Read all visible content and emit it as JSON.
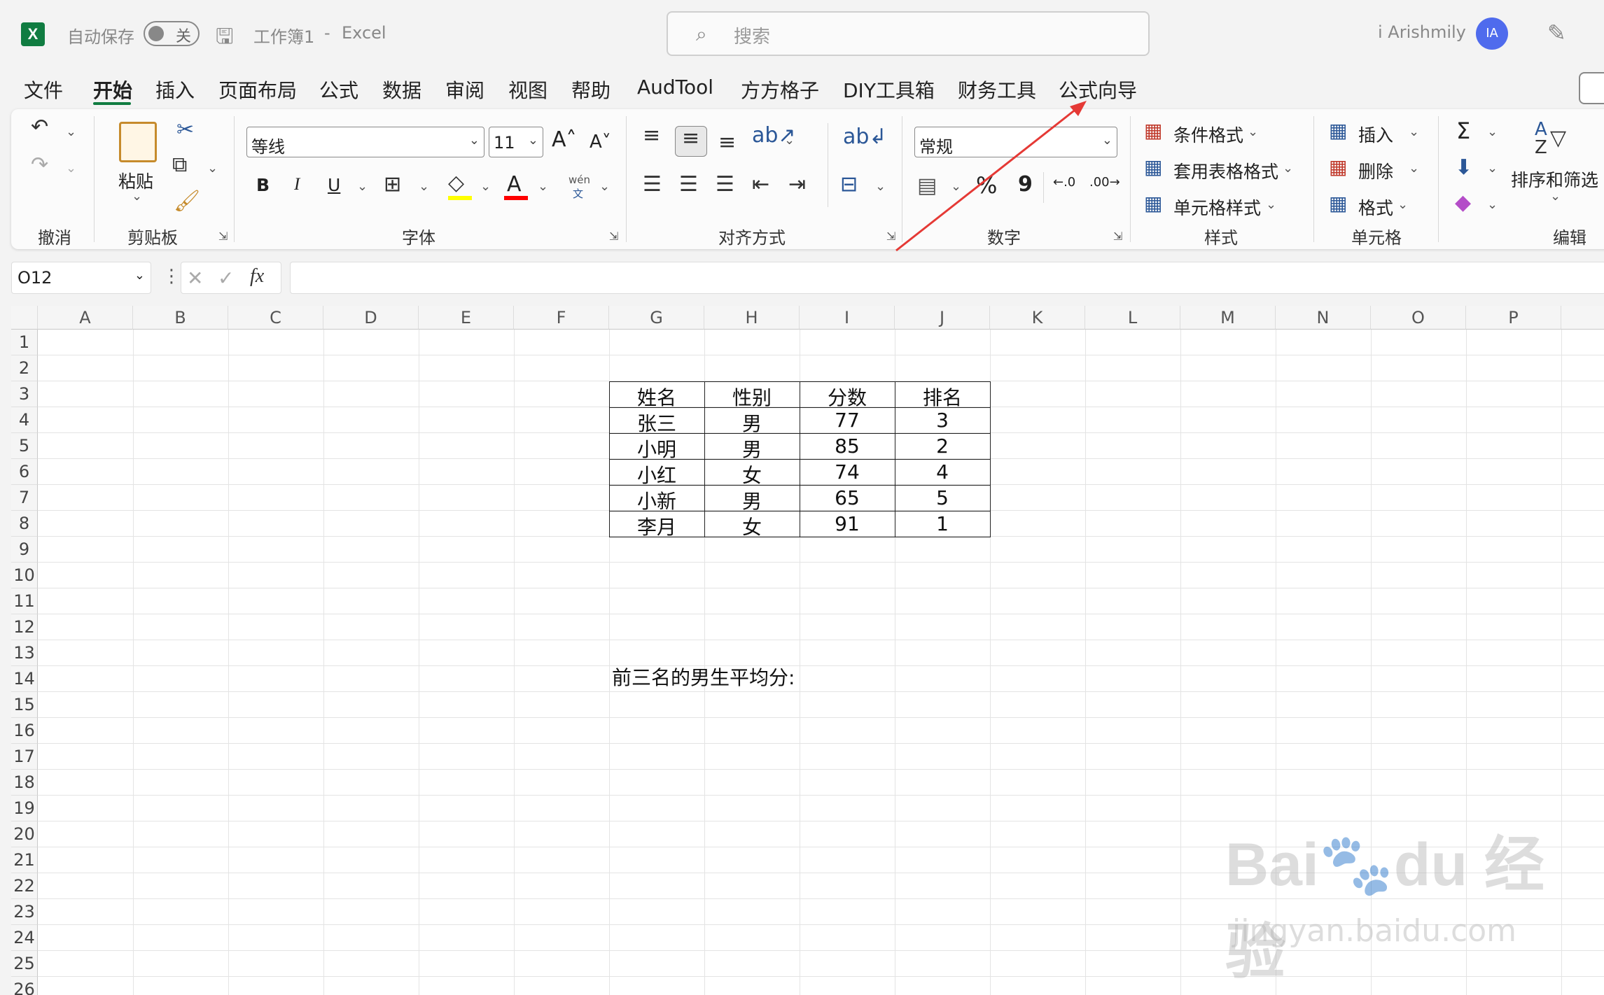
{
  "titlebar": {
    "autosave_label": "自动保存",
    "autosave_state": "关",
    "workbook": "工作簿1",
    "separator": "-",
    "app": "Excel",
    "search_placeholder": "搜索",
    "user_name": "i Arishmily",
    "user_initials": "IA"
  },
  "tabs": [
    {
      "label": "文件"
    },
    {
      "label": "开始"
    },
    {
      "label": "插入"
    },
    {
      "label": "页面布局"
    },
    {
      "label": "公式"
    },
    {
      "label": "数据"
    },
    {
      "label": "审阅"
    },
    {
      "label": "视图"
    },
    {
      "label": "帮助"
    },
    {
      "label": "AudTool"
    },
    {
      "label": "方方格子"
    },
    {
      "label": "DIY工具箱"
    },
    {
      "label": "财务工具"
    },
    {
      "label": "公式向导"
    }
  ],
  "active_tab": "开始",
  "ribbon": {
    "groups": {
      "undo": "撤消",
      "clipboard": "剪贴板",
      "font": "字体",
      "alignment": "对齐方式",
      "number": "数字",
      "styles": "样式",
      "cells": "单元格",
      "editing": "编辑"
    },
    "paste_label": "粘贴",
    "font_name": "等线",
    "font_size": "11",
    "bold": "B",
    "italic": "I",
    "underline": "U",
    "phonetic_top": "wén",
    "phonetic_bottom": "文",
    "number_format": "常规",
    "percent": "%",
    "comma": "9",
    "conditional_format": "条件格式",
    "table_format": "套用表格格式",
    "cell_styles": "单元格样式",
    "insert": "插入",
    "delete": "删除",
    "format": "格式",
    "sum": "Σ",
    "sort_filter": "排序和筛选",
    "sort_az_a": "A",
    "sort_az_z": "Z"
  },
  "formula_bar": {
    "name_box": "O12",
    "formula": ""
  },
  "sheet": {
    "columns": [
      "A",
      "B",
      "C",
      "D",
      "E",
      "F",
      "G",
      "H",
      "I",
      "J",
      "K",
      "L",
      "M",
      "N",
      "O",
      "P"
    ],
    "rows": [
      "1",
      "2",
      "3",
      "4",
      "5",
      "6",
      "7",
      "8",
      "9",
      "10",
      "11",
      "12",
      "13",
      "14",
      "15",
      "16",
      "17",
      "18",
      "19",
      "20",
      "21",
      "22",
      "23",
      "24",
      "25",
      "26"
    ],
    "table_header": [
      "姓名",
      "性别",
      "分数",
      "排名"
    ],
    "table_rows": [
      [
        "张三",
        "男",
        "77",
        "3"
      ],
      [
        "小明",
        "男",
        "85",
        "2"
      ],
      [
        "小红",
        "女",
        "74",
        "4"
      ],
      [
        "小新",
        "男",
        "65",
        "5"
      ],
      [
        "李月",
        "女",
        "91",
        "1"
      ]
    ],
    "note": "前三名的男生平均分:"
  },
  "watermark": {
    "brand": "Bai du 经验",
    "url": "jingyan.baidu.com"
  },
  "colors": {
    "excel_green": "#107c41",
    "annotation_arrow": "#e53935",
    "avatar": "#4f6bed",
    "highlight_yellow": "#ffff00",
    "font_red": "#ff0000"
  }
}
